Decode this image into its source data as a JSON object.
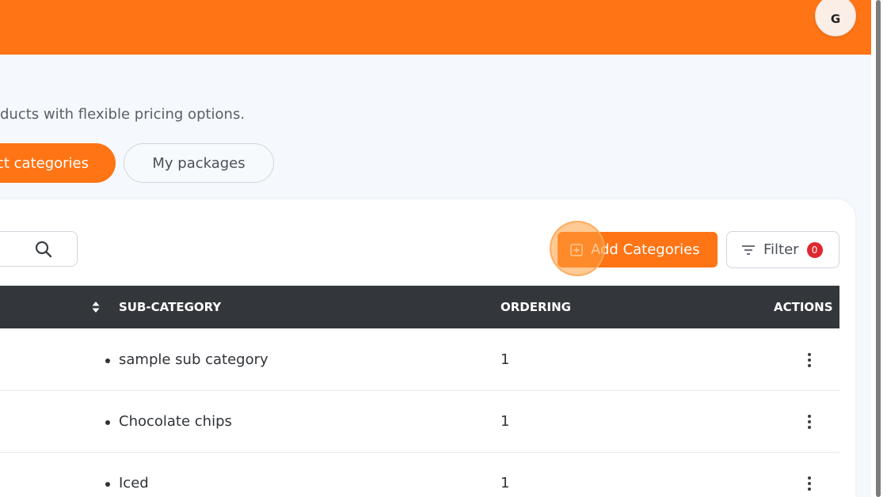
{
  "header": {
    "avatar_initial": "G",
    "accent_color": "#ff7414"
  },
  "page": {
    "subtitle": "ducts with flexible pricing options."
  },
  "tabs": [
    {
      "label": "ct categories",
      "active": true
    },
    {
      "label": "My packages",
      "active": false
    }
  ],
  "toolbar": {
    "search_icon": "search-icon",
    "add_label": "Add Categories",
    "filter_label": "Filter",
    "filter_count": "0"
  },
  "table": {
    "columns": [
      "SUB-CATEGORY",
      "ORDERING",
      "ACTIONS"
    ],
    "rows": [
      {
        "sub_category": "sample sub category",
        "ordering": "1"
      },
      {
        "sub_category": "Chocolate chips",
        "ordering": "1"
      },
      {
        "sub_category": "Iced",
        "ordering": "1"
      }
    ]
  }
}
